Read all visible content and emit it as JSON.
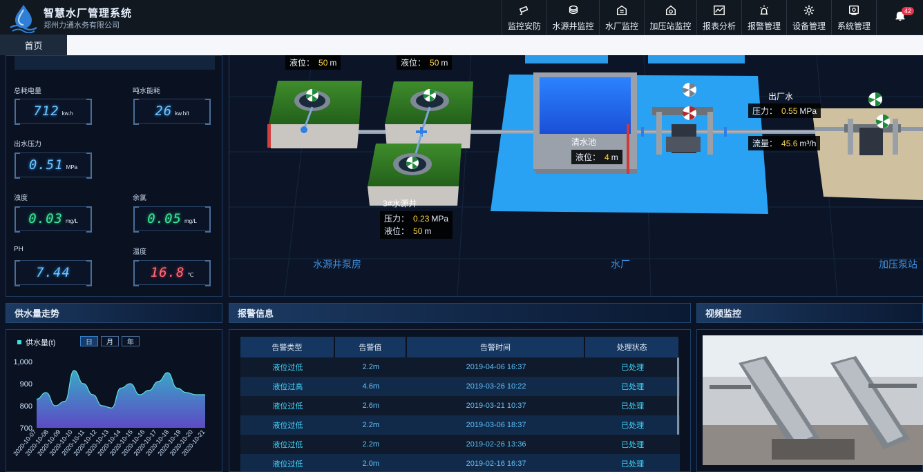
{
  "header": {
    "title": "智慧水厂管理系统",
    "subtitle": "郑州力通水务有限公司",
    "nav": [
      {
        "label": "监控安防",
        "icon": "camera-icon"
      },
      {
        "label": "水源井监控",
        "icon": "well-icon"
      },
      {
        "label": "水厂监控",
        "icon": "plant-icon"
      },
      {
        "label": "加压站监控",
        "icon": "pump-station-icon"
      },
      {
        "label": "报表分析",
        "icon": "chart-icon"
      },
      {
        "label": "报警管理",
        "icon": "alarm-light-icon"
      },
      {
        "label": "设备管理",
        "icon": "gear-icon"
      },
      {
        "label": "系统管理",
        "icon": "system-icon"
      }
    ],
    "notification_count": "42"
  },
  "tabs": {
    "home": "首页"
  },
  "metrics": {
    "total_power": {
      "label": "总耗电量",
      "value": "712",
      "unit": "kw.h"
    },
    "energy_per_ton": {
      "label": "吨水能耗",
      "value": "26",
      "unit": "kw.h/t"
    },
    "outlet_pressure": {
      "label": "出水压力",
      "value": "0.51",
      "unit": "MPa"
    },
    "turbidity": {
      "label": "浊度",
      "value": "0.03",
      "unit": "mg/L"
    },
    "residual_chlorine": {
      "label": "余氯",
      "value": "0.05",
      "unit": "mg/L"
    },
    "ph": {
      "label": "PH",
      "value": "7.44",
      "unit": ""
    },
    "temperature": {
      "label": "温度",
      "value": "16.8",
      "unit": "℃"
    }
  },
  "scene": {
    "well1": {
      "level_label": "液位：",
      "level_value": "50",
      "level_unit": "m"
    },
    "well2": {
      "level_label": "液位：",
      "level_value": "50",
      "level_unit": "m"
    },
    "well3": {
      "name": "3#水源井",
      "pressure_label": "压力：",
      "pressure_value": "0.23",
      "pressure_unit": "MPa",
      "level_label": "液位：",
      "level_value": "50",
      "level_unit": "m"
    },
    "clear_pool": {
      "name": "清水池",
      "level_label": "液位：",
      "level_value": "4",
      "level_unit": "m"
    },
    "outlet": {
      "name": "出厂水",
      "pressure_label": "压力：",
      "pressure_value": "0.55",
      "pressure_unit": "MPa",
      "flow_label": "流量：",
      "flow_value": "45.6",
      "flow_unit": "m³/h"
    },
    "zone_labels": {
      "source": "水源井泵房",
      "plant": "水厂",
      "booster": "加压泵站"
    }
  },
  "supply": {
    "section_title": "供水量走势",
    "legend": "供水量(t)",
    "ranges": [
      "日",
      "月",
      "年"
    ],
    "active_range": "日"
  },
  "chart_data": {
    "type": "area",
    "title": "",
    "series": [
      {
        "name": "供水量(t)",
        "values": [
          830,
          860,
          800,
          820,
          960,
          900,
          850,
          800,
          790,
          880,
          900,
          850,
          870,
          910,
          950,
          880,
          860,
          850,
          850
        ]
      }
    ],
    "x": [
      "2020-10-07",
      "2020-10-08",
      "2020-10-09",
      "2020-10-10",
      "2020-10-11",
      "2020-10-12",
      "2020-10-13",
      "2020-10-14",
      "2020-10-15",
      "2020-10-16",
      "2020-10-17",
      "2020-10-18",
      "2020-10-19",
      "2020-10-20",
      "2020-10-21"
    ],
    "ylim": [
      700,
      1000
    ],
    "yticks": [
      "1,000",
      "900",
      "800",
      "700"
    ],
    "color_top": "#3aa7c7",
    "color_bottom": "#5c4bc4"
  },
  "alarms": {
    "section_title": "报警信息",
    "columns": [
      "告警类型",
      "告警值",
      "告警时间",
      "处理状态"
    ],
    "rows": [
      [
        "液位过低",
        "2.2m",
        "2019-04-06 16:37",
        "已处理"
      ],
      [
        "液位过高",
        "4.6m",
        "2019-03-26 10:22",
        "已处理"
      ],
      [
        "液位过低",
        "2.6m",
        "2019-03-21 10:37",
        "已处理"
      ],
      [
        "液位过低",
        "2.2m",
        "2019-03-06 18:37",
        "已处理"
      ],
      [
        "液位过低",
        "2.2m",
        "2019-02-26 13:36",
        "已处理"
      ],
      [
        "液位过低",
        "2.0m",
        "2019-02-16 16:37",
        "已处理"
      ]
    ]
  },
  "video": {
    "section_title": "视频监控"
  }
}
